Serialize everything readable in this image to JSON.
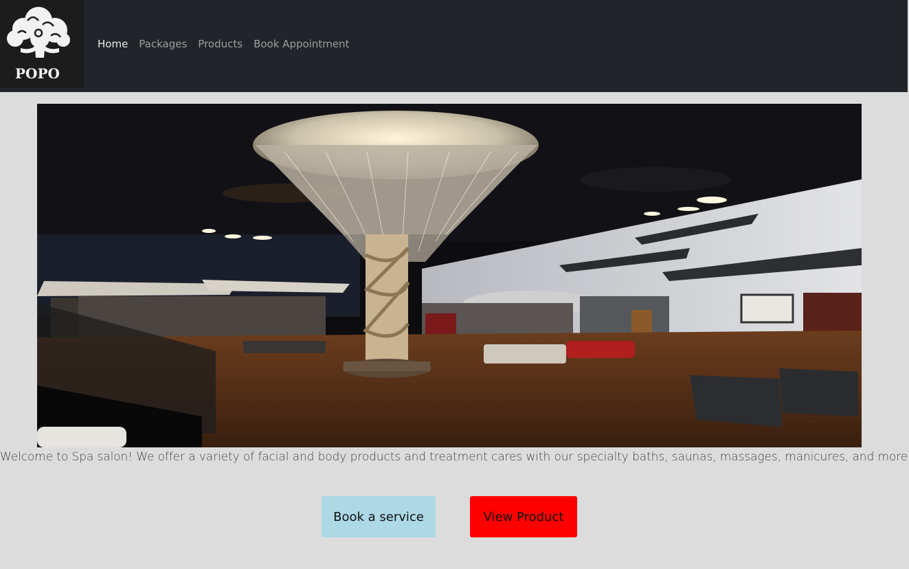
{
  "brand": {
    "logo_text": "POPO"
  },
  "nav": {
    "items": [
      {
        "label": "Home",
        "active": true
      },
      {
        "label": "Packages",
        "active": false
      },
      {
        "label": "Products",
        "active": false
      },
      {
        "label": "Book Appointment",
        "active": false
      }
    ]
  },
  "hero": {
    "alt": "Spa lobby with crystal chandelier"
  },
  "welcome_text": "Welcome to Spa salon! We offer a variety of facial and body products and treatment cares with our specialty baths, saunas, massages, manicures, and more.",
  "actions": {
    "book_label": "Book a service",
    "view_label": "View Product"
  },
  "colors": {
    "navbar": "#212529",
    "background": "#dcdcdc",
    "book_button": "#add8e6",
    "view_button": "#ff0000"
  }
}
